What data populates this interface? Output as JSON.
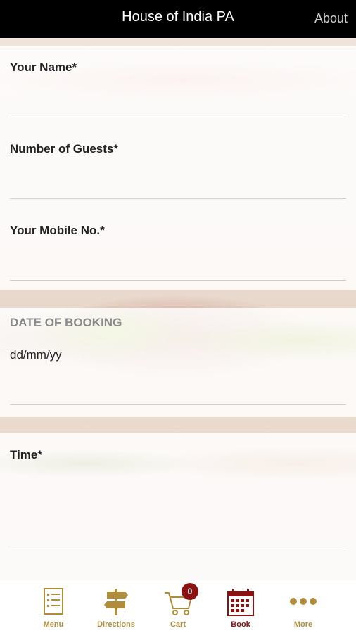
{
  "header": {
    "title": "House of India PA",
    "about_label": "About"
  },
  "form": {
    "name_label": "Your Name*",
    "guests_label": "Number of Guests*",
    "mobile_label": "Your Mobile No.*",
    "date_section_title": "DATE OF BOOKING",
    "date_placeholder": "dd/mm/yy",
    "time_label": "Time*"
  },
  "tabbar": {
    "items": [
      {
        "label": "Menu",
        "icon": "menu-list-icon"
      },
      {
        "label": "Directions",
        "icon": "signpost-icon"
      },
      {
        "label": "Cart",
        "icon": "cart-icon",
        "badge": "0"
      },
      {
        "label": "Book",
        "icon": "calendar-icon",
        "active": true
      },
      {
        "label": "More",
        "icon": "more-dots-icon"
      }
    ],
    "accent_color": "#b08d3c",
    "active_color": "#8b1212"
  }
}
